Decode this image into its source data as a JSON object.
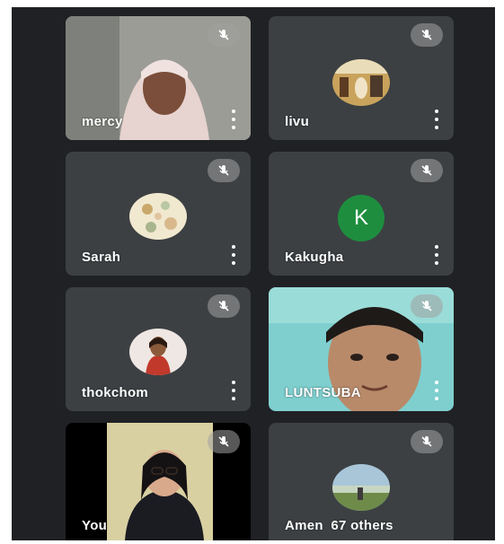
{
  "app": {
    "accent": "#202124",
    "tile_bg": "#3c4043",
    "mute_icon": "mic-off-icon",
    "more_icon": "more-vert-icon"
  },
  "participants": [
    {
      "name": "mercy",
      "type": "video",
      "muted": true
    },
    {
      "name": "livu",
      "type": "photo",
      "muted": true
    },
    {
      "name": "Sarah",
      "type": "photo",
      "muted": true
    },
    {
      "name": "Kakugha",
      "type": "letter",
      "letter": "K",
      "avatar_color": "#1e8e3e",
      "muted": true
    },
    {
      "name": "thokchom",
      "type": "photo",
      "muted": true
    },
    {
      "name": "LUNTSUBA",
      "type": "video",
      "muted": true
    },
    {
      "name": "You",
      "type": "video",
      "muted": true
    },
    {
      "name": "Amen",
      "type": "photo",
      "muted": true,
      "overflow_label": "67 others"
    }
  ]
}
